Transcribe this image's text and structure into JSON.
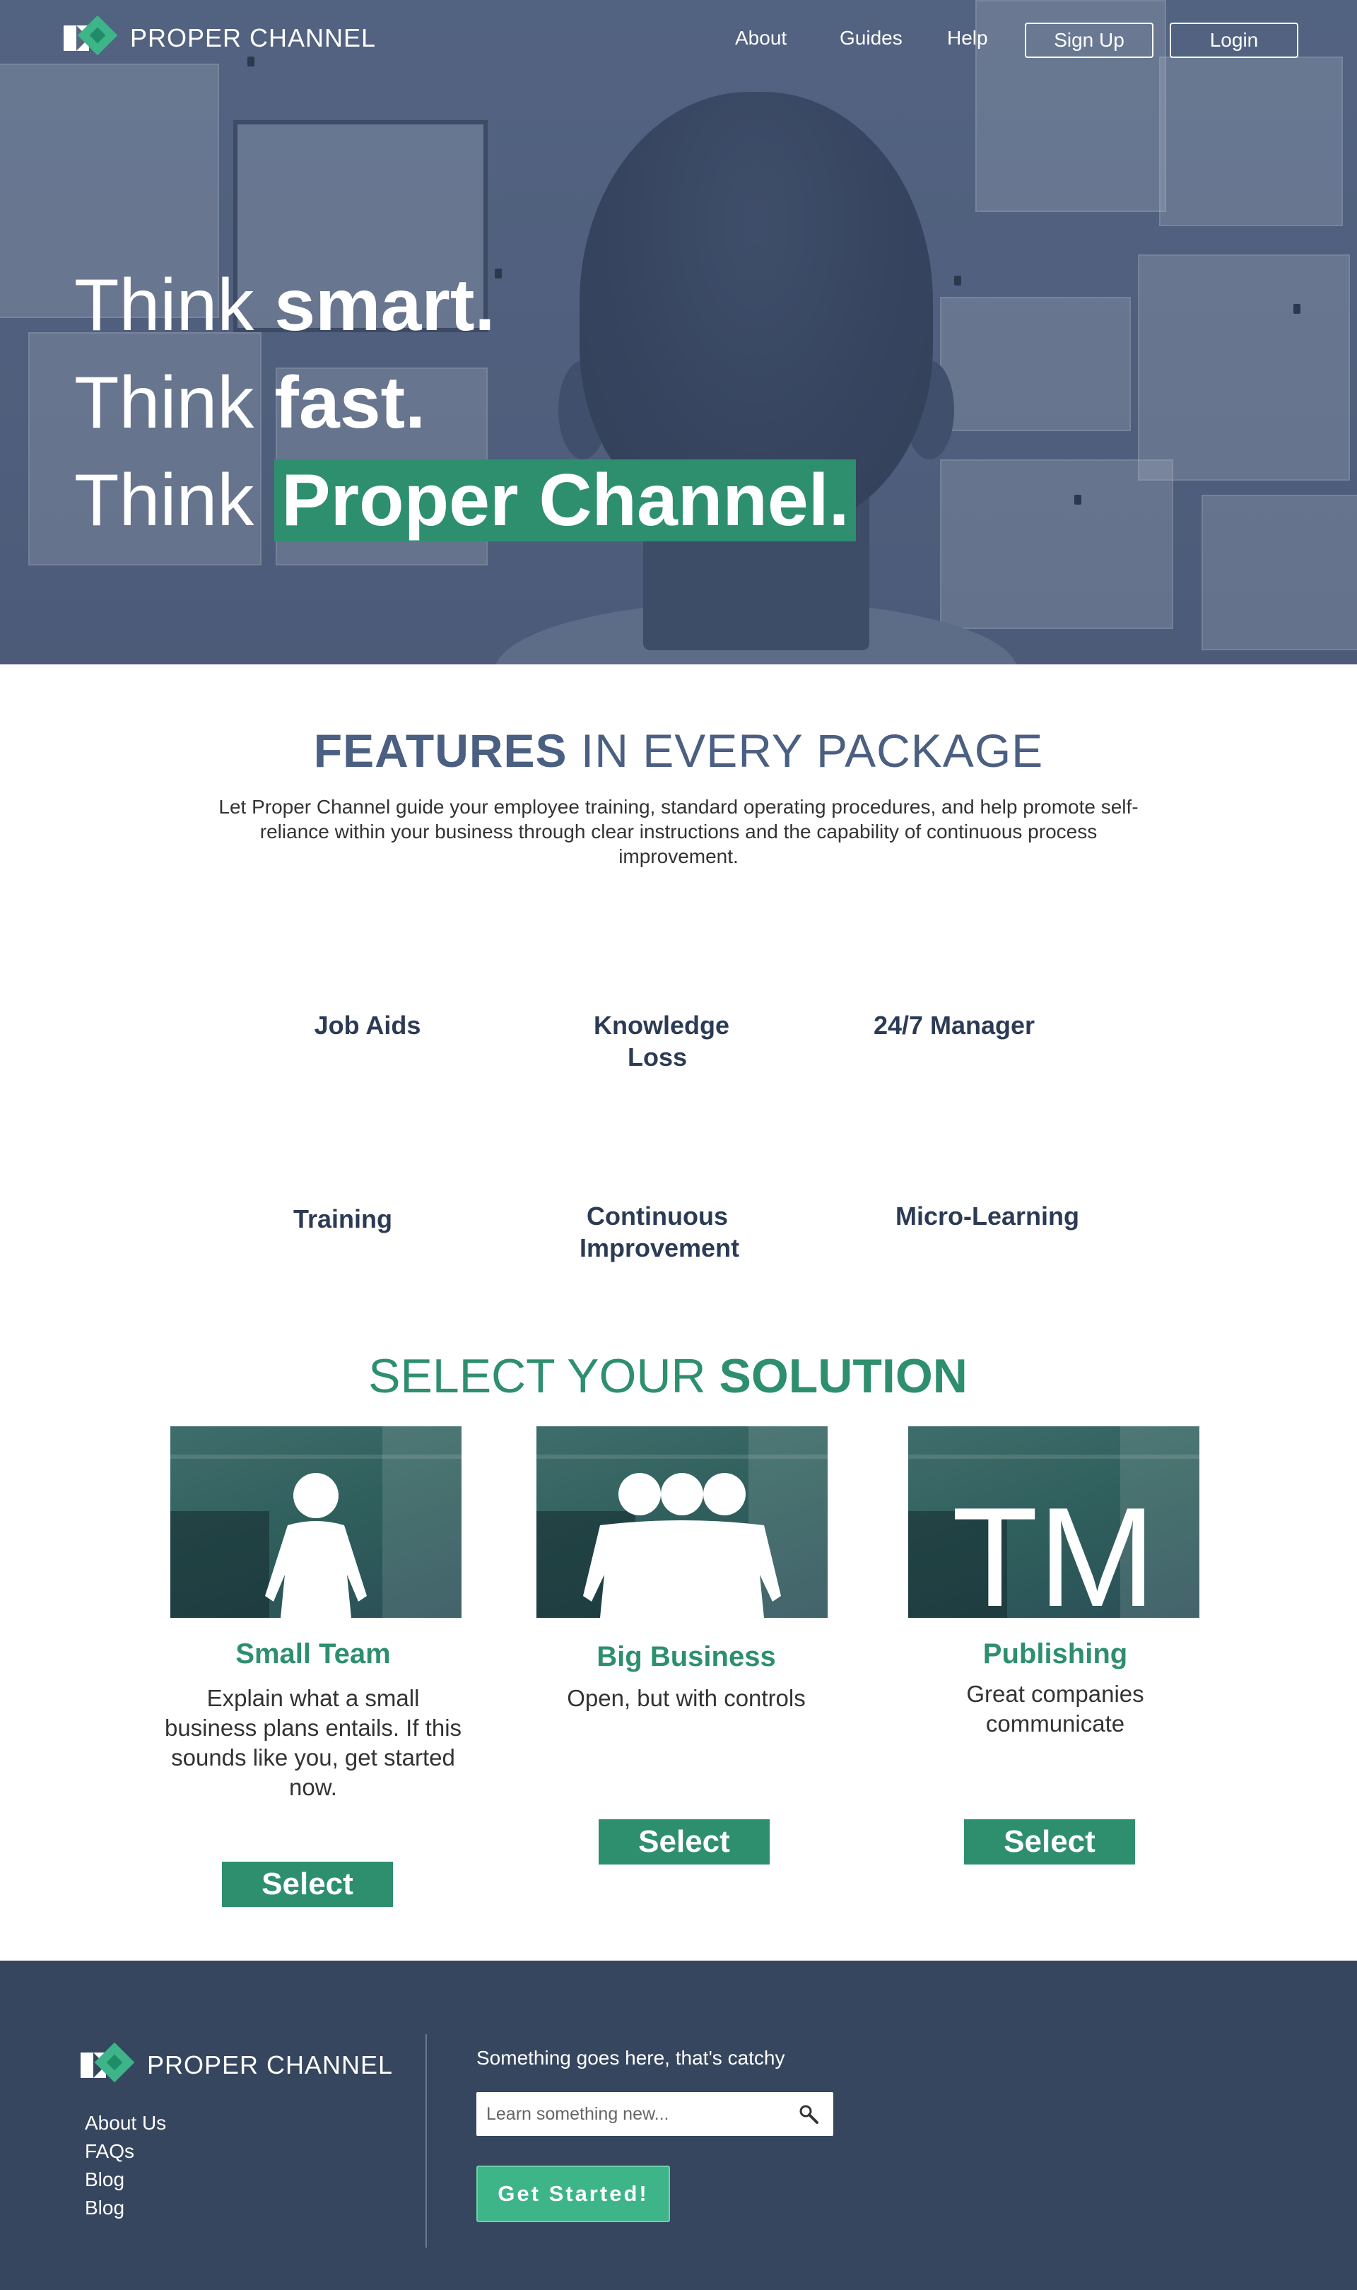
{
  "brand": {
    "name": "PROPER CHANNEL"
  },
  "nav": {
    "links": [
      "About",
      "Guides",
      "Help"
    ],
    "signup_label": "Sign Up",
    "login_label": "Login"
  },
  "hero": {
    "line1_prefix": "Think ",
    "line1_bold": "smart.",
    "line2_prefix": "Think ",
    "line2_bold": "fast.",
    "line3_prefix": "Think ",
    "line3_highlight": "Proper Channel."
  },
  "features": {
    "title_bold": "FEATURES",
    "title_rest": " IN EVERY PACKAGE",
    "description": "Let Proper Channel guide your employee training, standard operating procedures, and help promote self-reliance within your business through clear instructions and the capability of continuous process improvement.",
    "items": [
      "Job Aids",
      "Knowledge Loss",
      "24/7 Manager",
      "Training",
      "Continuous Improvement",
      "Micro-Learning"
    ]
  },
  "solutions": {
    "title_prefix": "SELECT YOUR ",
    "title_bold": "SOLUTION",
    "cards": [
      {
        "title": "Small Team",
        "description": "Explain what a small business plans entails. If this sounds like you, get started now.",
        "button": "Select",
        "icon": "single-person-icon"
      },
      {
        "title": "Big Business",
        "description": "Open, but with controls",
        "button": "Select",
        "icon": "group-people-icon"
      },
      {
        "title": "Publishing",
        "description": "Great companies communicate",
        "button": "Select",
        "icon_text": "TM"
      }
    ]
  },
  "footer": {
    "links": [
      "About Us",
      "FAQs",
      "Blog",
      "Blog"
    ],
    "catchy": "Something goes here, that's catchy",
    "search_placeholder": "Learn something new...",
    "cta_label": "Get Started!"
  },
  "colors": {
    "accent_green": "#2e8f6e",
    "cta_green": "#3eb489",
    "navy": "#37465f",
    "heading_blue": "#4a5f82"
  }
}
